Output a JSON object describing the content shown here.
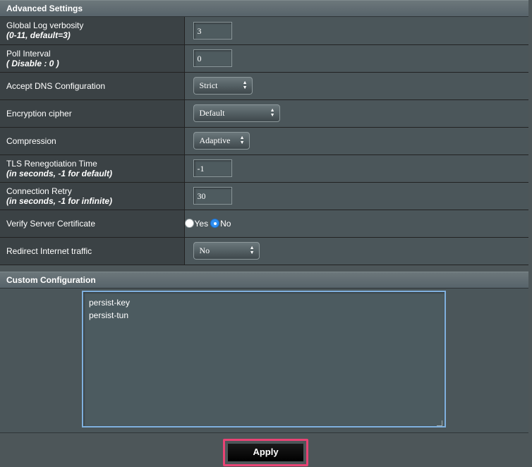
{
  "advanced": {
    "title": "Advanced Settings",
    "rows": [
      {
        "label": "Global Log verbosity",
        "sub": "(0-11, default=3)",
        "value": "3"
      },
      {
        "label": "Poll Interval",
        "sub": "( Disable : 0 )",
        "value": "0"
      },
      {
        "label": "Accept DNS Configuration",
        "value": "Strict"
      },
      {
        "label": "Encryption cipher",
        "value": "Default"
      },
      {
        "label": "Compression",
        "value": "Adaptive"
      },
      {
        "label": "TLS Renegotiation Time",
        "sub": "(in seconds, -1 for default)",
        "value": "-1"
      },
      {
        "label": "Connection Retry",
        "sub": "(in seconds, -1 for infinite)",
        "value": "30"
      },
      {
        "label": "Verify Server Certificate",
        "options": [
          "Yes",
          "No"
        ],
        "selected": "No"
      },
      {
        "label": "Redirect Internet traffic",
        "value": "No"
      }
    ]
  },
  "custom": {
    "title": "Custom Configuration",
    "content": "persist-key\npersist-tun"
  },
  "apply_label": "Apply",
  "colors": {
    "accent": "#2f8ff0",
    "highlight": "#e84374"
  }
}
